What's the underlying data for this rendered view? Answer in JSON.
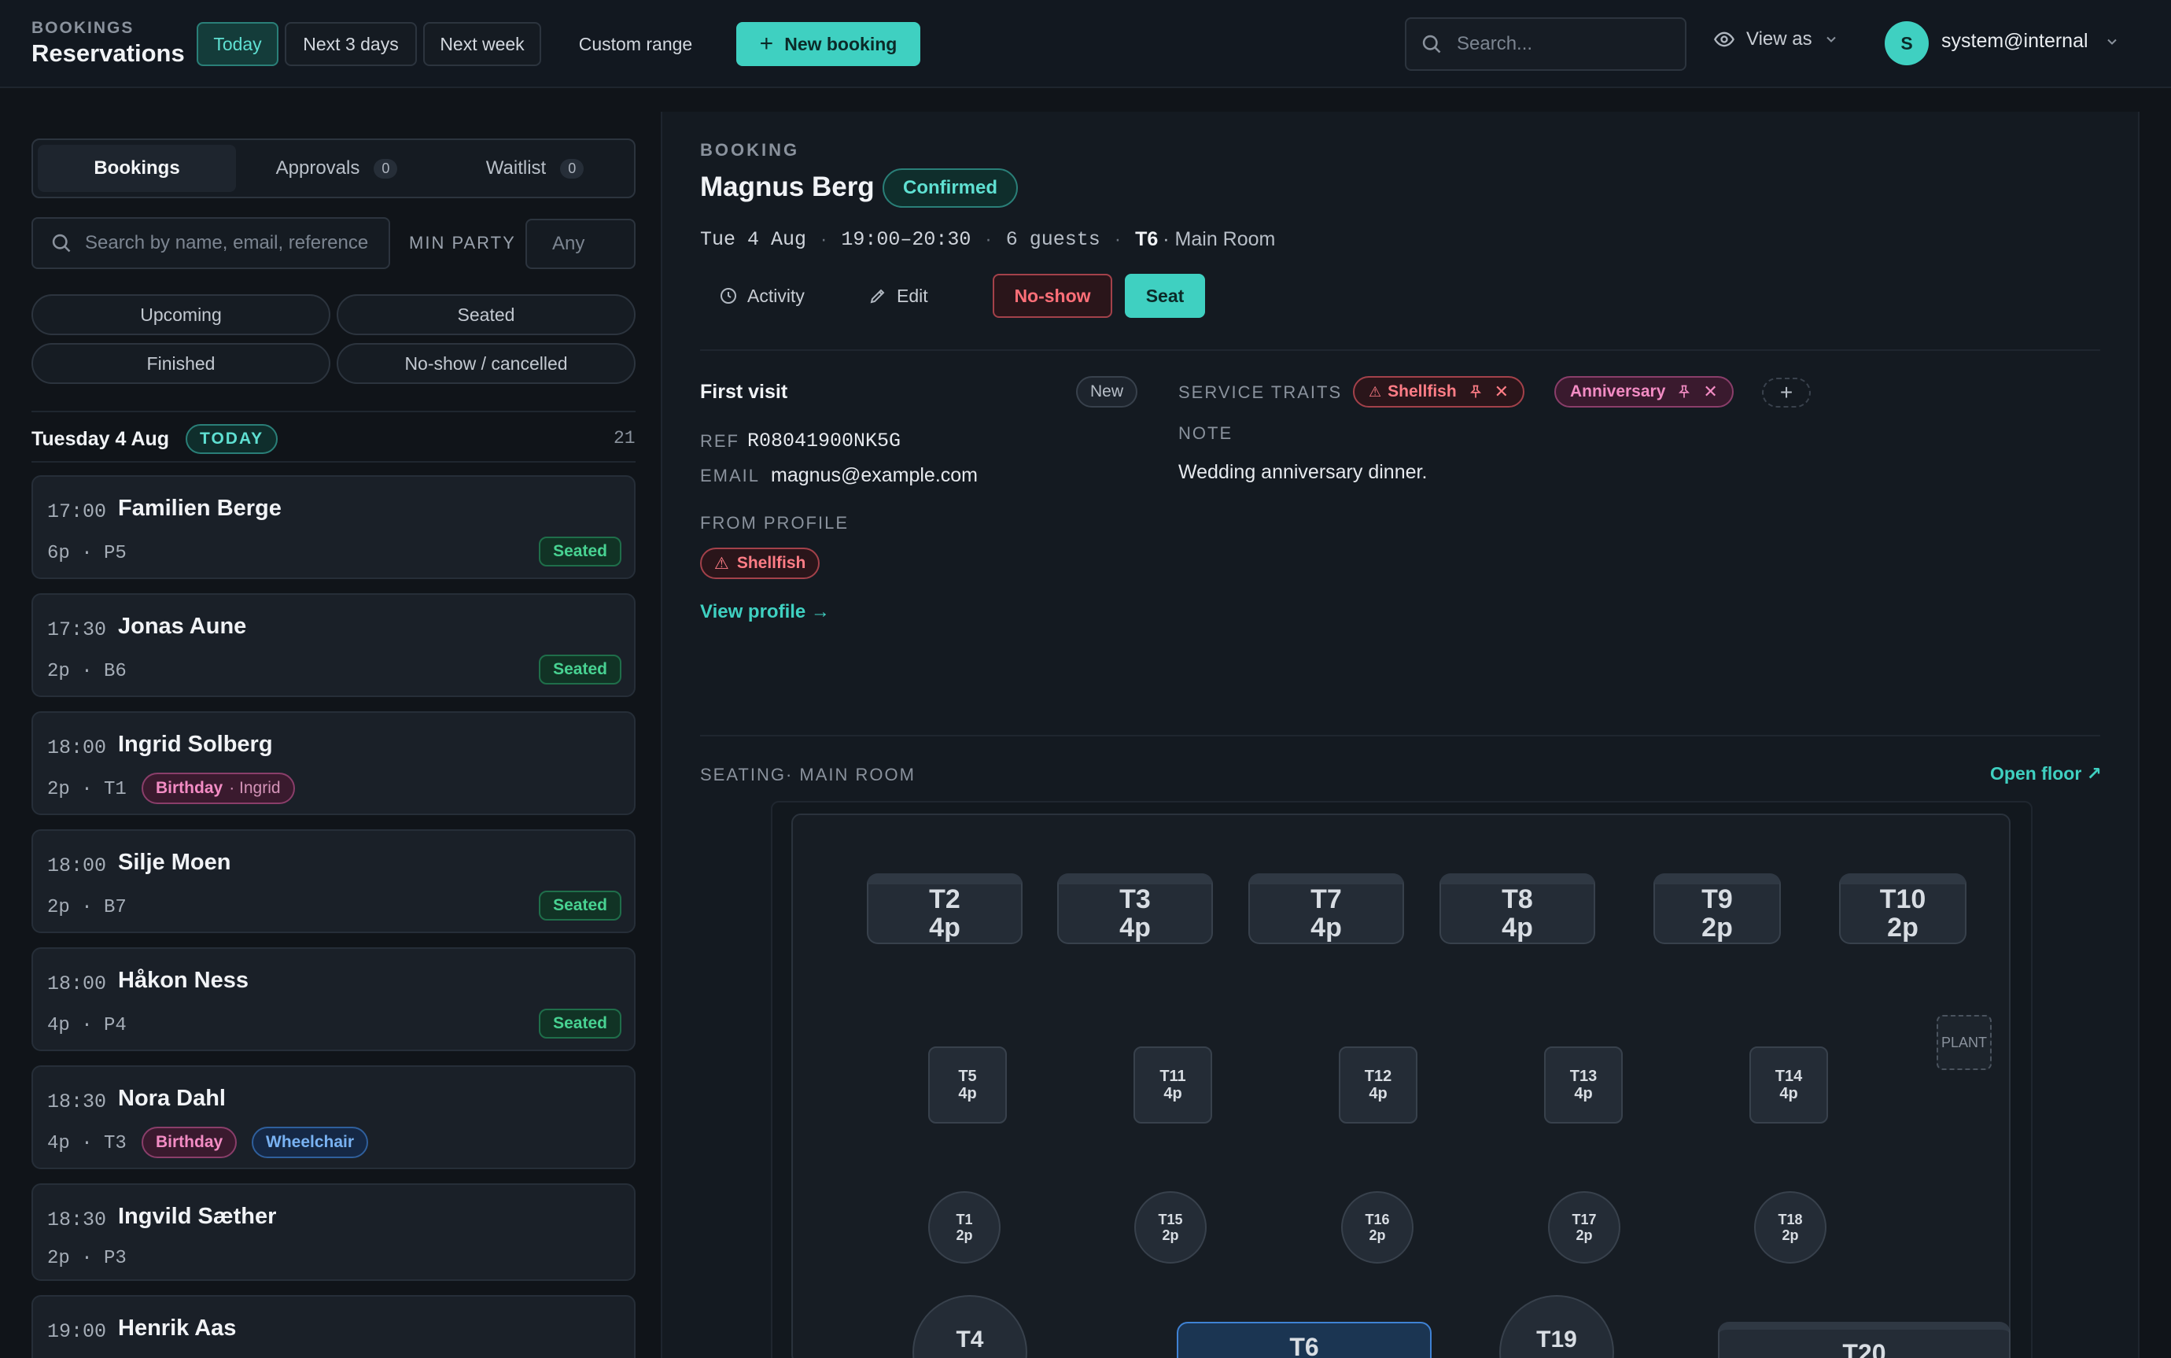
{
  "header": {
    "kicker": "BOOKINGS",
    "title": "Reservations",
    "ranges": [
      "Today",
      "Next 3 days",
      "Next week",
      "Custom range"
    ],
    "new_booking": "New booking",
    "search_placeholder": "Search...",
    "view_as": "View as",
    "user_initial": "S",
    "user_email": "system@internal",
    "accent": "#3fd0c1"
  },
  "left": {
    "tabs": [
      {
        "label": "Bookings",
        "count": ""
      },
      {
        "label": "Approvals",
        "count": "0"
      },
      {
        "label": "Waitlist",
        "count": "0"
      }
    ],
    "search_placeholder": "Search by name, email, reference",
    "min_party_label": "MIN PARTY",
    "min_party_placeholder": "Any",
    "filters": [
      "Upcoming",
      "Seated",
      "Finished",
      "No-show / cancelled"
    ],
    "day_label": "Tuesday 4 Aug",
    "today_badge": "TODAY",
    "day_count": "21",
    "bookings": [
      {
        "time": "17:00",
        "name": "Familien Berge",
        "meta": "6p · P5",
        "status": "Seated"
      },
      {
        "time": "17:30",
        "name": "Jonas Aune",
        "meta": "2p · B6",
        "status": "Seated"
      },
      {
        "time": "18:00",
        "name": "Ingrid Solberg",
        "meta": "2p · T1",
        "tag": "Birthday",
        "tag_sub": "· Ingrid"
      },
      {
        "time": "18:00",
        "name": "Silje Moen",
        "meta": "2p · B7",
        "status": "Seated"
      },
      {
        "time": "18:00",
        "name": "Håkon Ness",
        "meta": "4p · P4",
        "status": "Seated"
      },
      {
        "time": "18:30",
        "name": "Nora Dahl",
        "meta": "4p · T3",
        "tag": "Birthday",
        "tag2": "Wheelchair"
      },
      {
        "time": "18:30",
        "name": "Ingvild Sæther",
        "meta": "2p · P3"
      },
      {
        "time": "19:00",
        "name": "Henrik Aas",
        "meta": ""
      }
    ]
  },
  "booking": {
    "kicker": "BOOKING",
    "name": "Magnus Berg",
    "status": "Confirmed",
    "date": "Tue 4 Aug",
    "time": "19:00–20:30",
    "guests": "6 guests",
    "table": "T6",
    "room": "· Main Room",
    "actions": {
      "activity": "Activity",
      "edit": "Edit",
      "noshow": "No-show",
      "seat": "Seat"
    },
    "first_visit": "First visit",
    "new_badge": "New",
    "ref_label": "REF",
    "ref": "R08041900NK5G",
    "email_label": "EMAIL",
    "email": "magnus@example.com",
    "from_profile_label": "FROM PROFILE",
    "profile_tag": "Shellfish",
    "view_profile": "View profile →",
    "service_traits_label": "SERVICE TRAITS",
    "traits": [
      "Shellfish",
      "Anniversary"
    ],
    "note_label": "NOTE",
    "note": "Wedding anniversary dinner."
  },
  "seating": {
    "label": "SEATING· MAIN ROOM",
    "open_floor": "Open floor ↗",
    "plant": "PLANT",
    "tables": [
      {
        "id": "T2",
        "cap": "4p"
      },
      {
        "id": "T3",
        "cap": "4p"
      },
      {
        "id": "T7",
        "cap": "4p"
      },
      {
        "id": "T8",
        "cap": "4p"
      },
      {
        "id": "T9",
        "cap": "2p"
      },
      {
        "id": "T10",
        "cap": "2p"
      },
      {
        "id": "T5",
        "cap": "4p"
      },
      {
        "id": "T11",
        "cap": "4p"
      },
      {
        "id": "T12",
        "cap": "4p"
      },
      {
        "id": "T13",
        "cap": "4p"
      },
      {
        "id": "T14",
        "cap": "4p"
      },
      {
        "id": "T1",
        "cap": "2p"
      },
      {
        "id": "T15",
        "cap": "2p"
      },
      {
        "id": "T16",
        "cap": "2p"
      },
      {
        "id": "T17",
        "cap": "2p"
      },
      {
        "id": "T18",
        "cap": "2p"
      },
      {
        "id": "T4",
        "cap": ""
      },
      {
        "id": "T6",
        "cap": ""
      },
      {
        "id": "T19",
        "cap": ""
      },
      {
        "id": "T20",
        "cap": ""
      }
    ]
  }
}
